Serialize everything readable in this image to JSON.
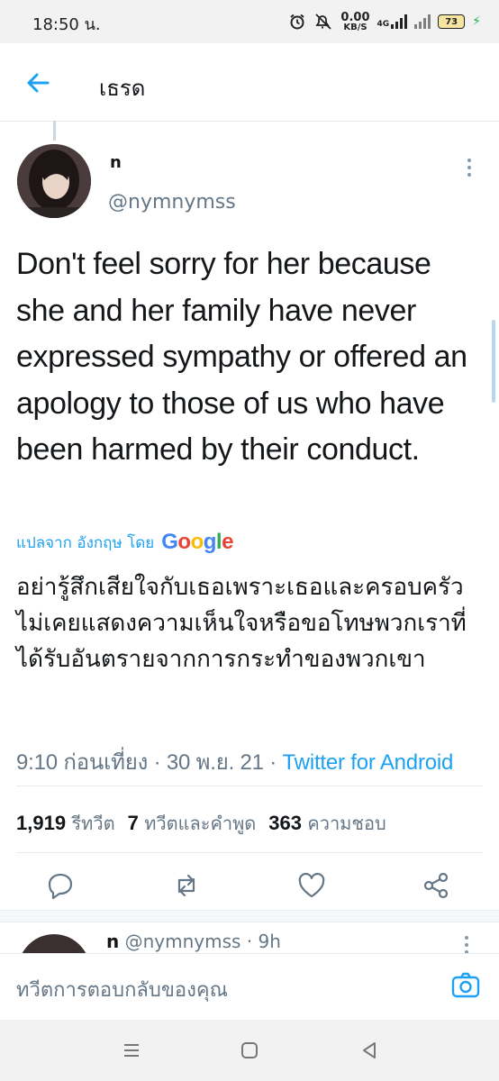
{
  "status_bar": {
    "time": "18:50 น.",
    "net_speed_value": "0.00",
    "net_speed_unit": "KB/S",
    "network": "4G",
    "battery": "73"
  },
  "header": {
    "title": "เธรด"
  },
  "tweet": {
    "author_name": "n",
    "author_handle": "@nymnymss",
    "text": "Don't feel sorry for her because she and her family have never expressed sympathy or offered an apology to those of us who have been harmed by their conduct.",
    "translated_label": "แปลจาก อังกฤษ โดย",
    "translator_brand": "Google",
    "translated_text": "อย่ารู้สึกเสียใจกับเธอเพราะเธอและครอบครัวไม่เคยแสดงความเห็นใจหรือขอโทษพวกเราที่ได้รับอันตรายจากการกระทำของพวกเขา",
    "time": "9:10 ก่อนเที่ยง · 30 พ.ย. 21 · ",
    "source": "Twitter for Android",
    "retweets_count": "1,919",
    "retweets_label": "รีทวีต",
    "quotes_count": "7",
    "quotes_label": "ทวีตและคำพูด",
    "likes_count": "363",
    "likes_label": "ความชอบ"
  },
  "reply_preview": {
    "name": "n",
    "handle_time": "@nymnymss · 9h"
  },
  "composer": {
    "placeholder": "ทวีตการตอบกลับของคุณ"
  },
  "colors": {
    "accent": "#1da1f2",
    "secondary_text": "#657786",
    "divider": "#e6ecf0"
  },
  "icons": [
    "back-arrow-icon",
    "more-vert-icon",
    "reply-icon",
    "retweet-icon",
    "like-icon",
    "share-icon",
    "camera-icon",
    "nav-menu-icon",
    "nav-home-icon",
    "nav-back-icon"
  ]
}
